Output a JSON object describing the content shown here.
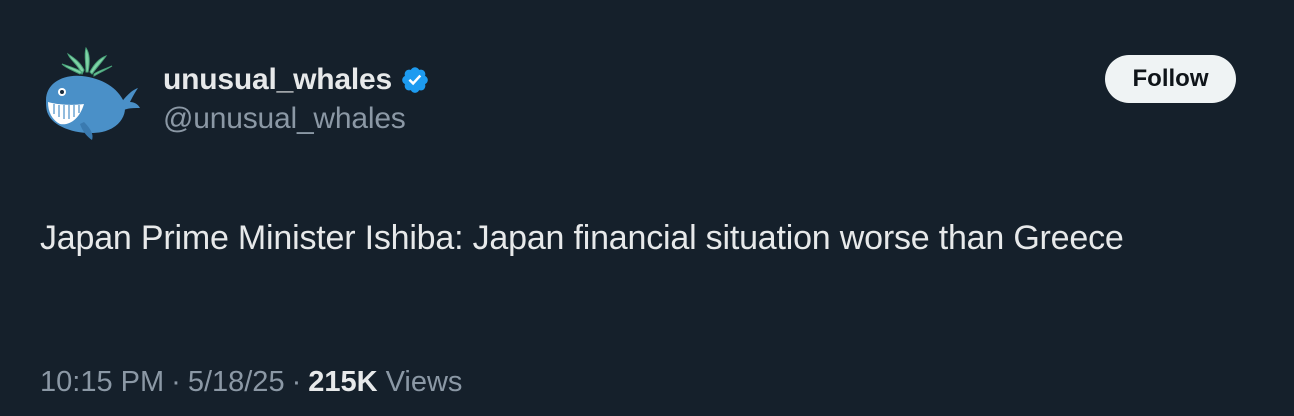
{
  "author": {
    "display_name": "unusual_whales",
    "handle": "@unusual_whales",
    "avatar_icon": "whale-icon",
    "verified_icon": "verified-badge-icon"
  },
  "follow_button": {
    "label": "Follow"
  },
  "tweet": {
    "text": "Japan Prime Minister Ishiba: Japan financial situation worse than Greece"
  },
  "meta": {
    "time": "10:15 PM",
    "separator": "·",
    "date": "5/18/25",
    "views_count": "215K",
    "views_label": "Views"
  },
  "colors": {
    "background": "#15202b",
    "text_primary": "#e7e9ea",
    "text_secondary": "#8b98a5",
    "verified_blue": "#1d9bf0",
    "button_bg": "#eff3f4"
  }
}
